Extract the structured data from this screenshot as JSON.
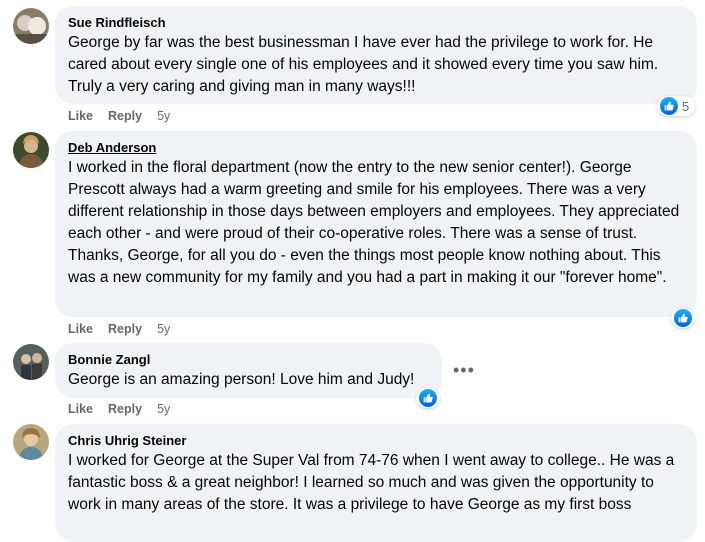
{
  "comments": [
    {
      "author": "Sue Rindfleisch",
      "text": "George by far was the best businessman I have ever had the privilege to work for. He cared about every single one of his employees and it showed every time you saw him. Truly a very caring and giving man in many ways!!!",
      "like": "Like",
      "reply": "Reply",
      "time": "5y",
      "reaction_count": "5"
    },
    {
      "author": "Deb Anderson",
      "text": "I worked in the floral department (now the entry to the new senior center!). George Prescott always had a warm greeting and smile for his employees. There was a very different relationship in those days between employers and employees. They appreciated each other - and were proud of their co-operative roles. There was a sense of trust. Thanks, George, for all you do - even the things most people know nothing about. This was a new community for my family and you had a part in making it our \"forever home\".",
      "like": "Like",
      "reply": "Reply",
      "time": "5y"
    },
    {
      "author": "Bonnie Zangl",
      "text": "George is an amazing person! Love him and Judy!",
      "like": "Like",
      "reply": "Reply",
      "time": "5y",
      "more": "•••"
    },
    {
      "author": "Chris Uhrig Steiner",
      "text": "I worked for George at the Super Val from 74-76 when I went away to college.. He was a fantastic boss & a great neighbor! I learned so much and was given the opportunity to work in many areas of the store. It was a privilege to have George as my first boss"
    }
  ],
  "colors": {
    "bubble": "#f0f2f5",
    "meta": "#65676b",
    "like_blue": "#1877f2"
  }
}
